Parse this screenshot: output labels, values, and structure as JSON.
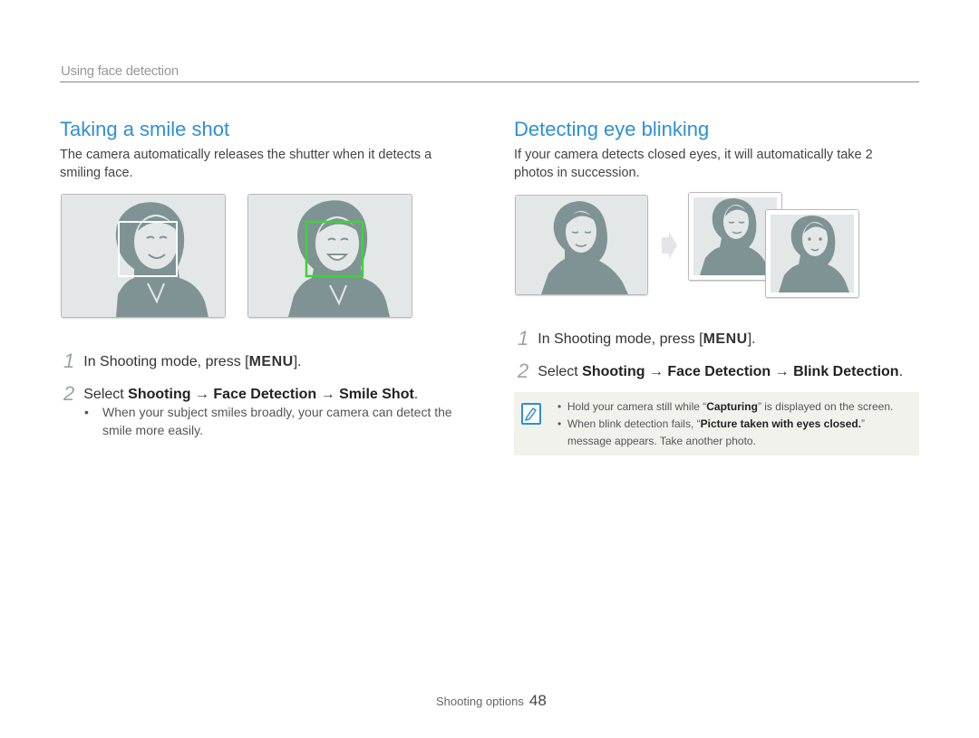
{
  "header": {
    "section_label": "Using face detection"
  },
  "left": {
    "title": "Taking a smile shot",
    "description": "The camera automatically releases the shutter when it detects a smiling face.",
    "step1": {
      "num": "1",
      "text": "In Shooting mode, press [",
      "key": "MENU",
      "end": "]."
    },
    "step2": {
      "num": "2",
      "pre": "Select ",
      "item1": "Shooting",
      "arrow": "→",
      "item2": "Face Detection",
      "item3": "Smile Shot",
      "end": "."
    },
    "bullet": "When your subject smiles broadly, your camera can detect the smile more easily."
  },
  "right": {
    "title": "Detecting eye blinking",
    "description": "If your camera detects closed eyes, it will automatically take 2 photos in succession.",
    "step1": {
      "num": "1",
      "text": "In Shooting mode, press [",
      "key": "MENU",
      "end": "]."
    },
    "step2": {
      "num": "2",
      "pre": "Select ",
      "item1": "Shooting",
      "arrow": "→",
      "item2": "Face Detection",
      "item3": "Blink Detection",
      "end": "."
    },
    "note": {
      "icon": "note-pencil-icon",
      "line1_pre": "Hold your camera still while “",
      "line1_bold": "Capturing",
      "line1_post": "” is displayed on the screen.",
      "line2_pre": "When blink detection fails, “",
      "line2_bold": "Picture taken with eyes closed.",
      "line2_post": "”",
      "line3": "message appears. Take another photo."
    }
  },
  "footer": {
    "label": "Shooting options",
    "page": "48"
  },
  "colors": {
    "accent": "#2e8fd6",
    "face_box_white": "#ffffff",
    "face_box_green": "#3fd23a",
    "silhouette": "#7f9394"
  }
}
